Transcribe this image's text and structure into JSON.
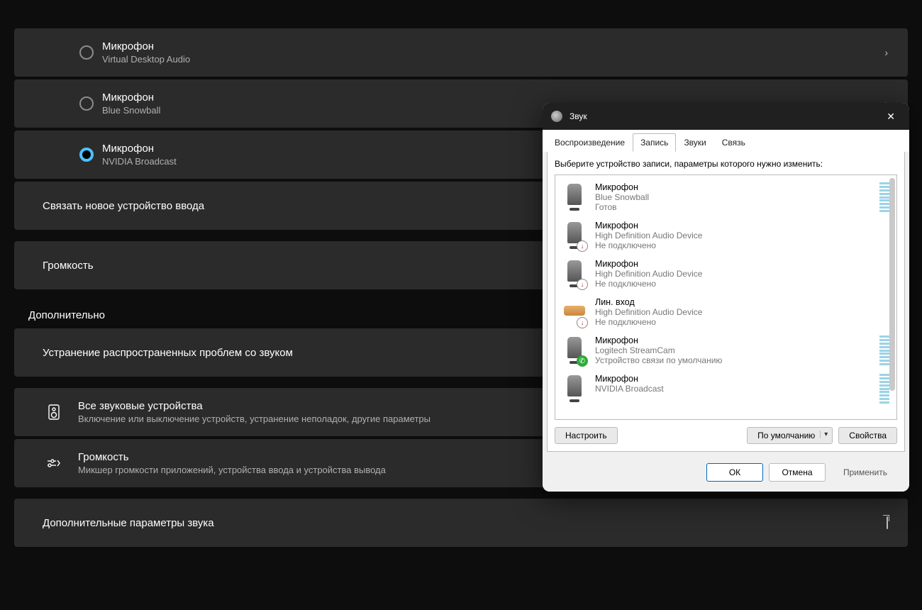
{
  "settings": {
    "mics": [
      {
        "title": "Микрофон",
        "sub": "Virtual Desktop Audio",
        "selected": false
      },
      {
        "title": "Микрофон",
        "sub": "Blue Snowball",
        "selected": false
      },
      {
        "title": "Микрофон",
        "sub": "NVIDIA Broadcast",
        "selected": true
      }
    ],
    "pair_device": "Связать новое устройство ввода",
    "volume_label": "Громкость",
    "advanced_heading": "Дополнительно",
    "troubleshoot": "Устранение распространенных проблем со звуком",
    "all_devices_title": "Все звуковые устройства",
    "all_devices_sub": "Включение или выключение устройств, устранение неполадок, другие параметры",
    "mixer_title": "Громкость",
    "mixer_sub": "Микшер громкости приложений, устройства ввода и устройства вывода",
    "more_sound": "Дополнительные параметры звука"
  },
  "dialog": {
    "title": "Звук",
    "tabs": [
      "Воспроизведение",
      "Запись",
      "Звуки",
      "Связь"
    ],
    "active_tab": 1,
    "instruction": "Выберите устройство записи, параметры которого нужно изменить:",
    "devices": [
      {
        "name": "Микрофон",
        "desc": "Blue Snowball",
        "state": "Готов",
        "icon": "mic",
        "badge": "",
        "meter": true
      },
      {
        "name": "Микрофон",
        "desc": "High Definition Audio Device",
        "state": "Не подключено",
        "icon": "mic",
        "badge": "down",
        "meter": false
      },
      {
        "name": "Микрофон",
        "desc": "High Definition Audio Device",
        "state": "Не подключено",
        "icon": "mic",
        "badge": "down",
        "meter": false
      },
      {
        "name": "Лин. вход",
        "desc": "High Definition Audio Device",
        "state": "Не подключено",
        "icon": "jack",
        "badge": "down",
        "meter": false
      },
      {
        "name": "Микрофон",
        "desc": "Logitech StreamCam",
        "state": "Устройство связи по умолчанию",
        "icon": "mic",
        "badge": "ok",
        "meter": true
      },
      {
        "name": "Микрофон",
        "desc": "NVIDIA Broadcast",
        "state": "",
        "icon": "mic",
        "badge": "",
        "meter": true
      }
    ],
    "configure": "Настроить",
    "default": "По умолчанию",
    "properties": "Свойства",
    "ok": "ОК",
    "cancel": "Отмена",
    "apply": "Применить"
  }
}
